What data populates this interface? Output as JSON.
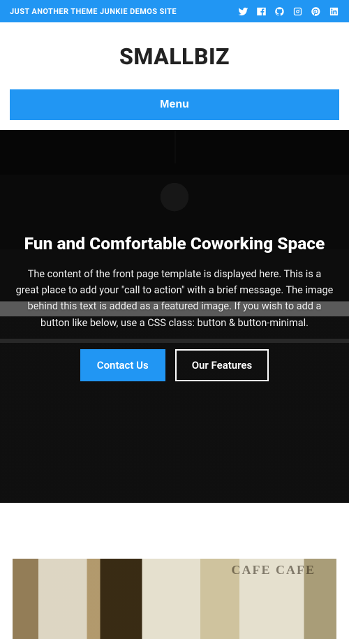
{
  "topbar": {
    "tagline": "JUST ANOTHER THEME JUNKIE DEMOS SITE",
    "icons": [
      "twitter",
      "facebook",
      "github",
      "instagram",
      "pinterest",
      "linkedin"
    ]
  },
  "site": {
    "title": "SMALLBIZ"
  },
  "nav": {
    "menu_label": "Menu"
  },
  "hero": {
    "title": "Fun and Comfortable Coworking Space",
    "description": "The content of the front page template is displayed here. This is a great place to add your \"call to action\" with a brief message. The image behind this text is added as a featured image. If you wish to add a button like below, use a CSS class: button & button-minimal.",
    "primary_button": "Contact Us",
    "secondary_button": "Our Features"
  },
  "secondary_image": {
    "overlay_text": "CAFE"
  }
}
